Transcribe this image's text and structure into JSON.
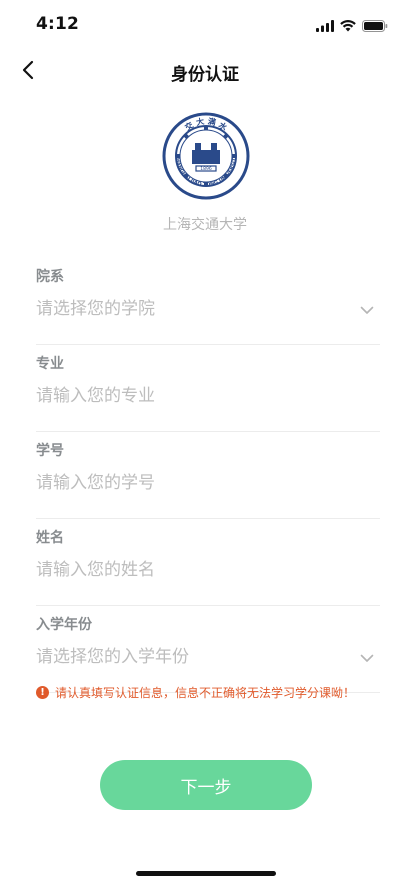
{
  "status_bar": {
    "time": "4:12",
    "icons": [
      "signal-icon",
      "wifi-icon",
      "battery-icon"
    ]
  },
  "nav": {
    "title": "身份认证",
    "back_icon": "chevron-left-icon"
  },
  "school": {
    "logo_text_top": "交 大 满 水",
    "logo_text_ring": "SHANGHAI JIAO TONG UNIVERSITY",
    "logo_year": "1896",
    "name": "上海交通大学"
  },
  "form": {
    "fields": [
      {
        "label": "院系",
        "placeholder": "请选择您的学院",
        "type": "select"
      },
      {
        "label": "专业",
        "placeholder": "请输入您的专业",
        "type": "text"
      },
      {
        "label": "学号",
        "placeholder": "请输入您的学号",
        "type": "text"
      },
      {
        "label": "姓名",
        "placeholder": "请输入您的姓名",
        "type": "text"
      },
      {
        "label": "入学年份",
        "placeholder": "请选择您的入学年份",
        "type": "select"
      }
    ]
  },
  "warning": {
    "icon": "exclamation-circle-icon",
    "text": "请认真填写认证信息，信息不正确将无法学习学分课呦！"
  },
  "next_button": {
    "label": "下一步"
  },
  "colors": {
    "accent": "#68d79b",
    "warning": "#e05a2b",
    "logo_blue": "#2a4a8a"
  }
}
